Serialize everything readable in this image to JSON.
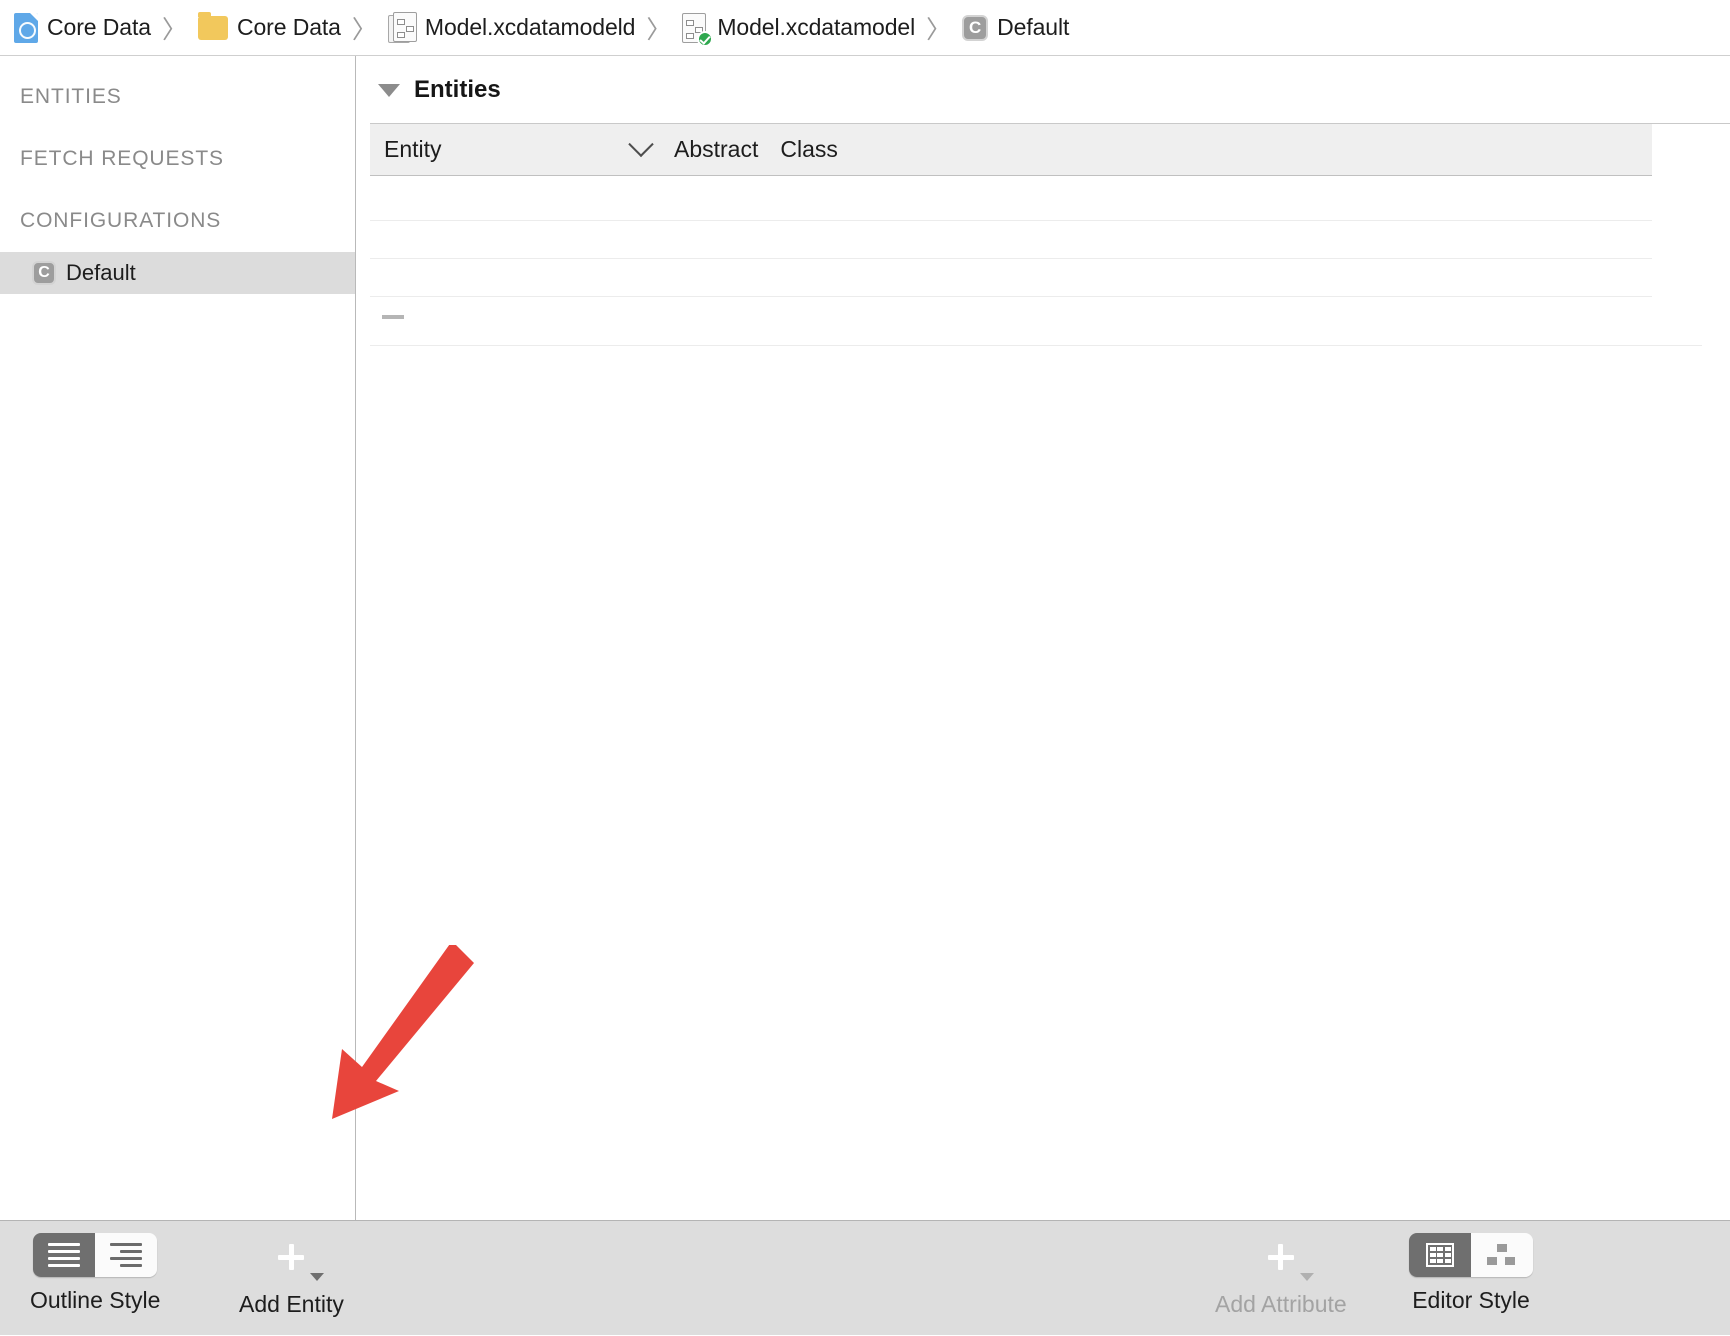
{
  "breadcrumb": {
    "items": [
      {
        "label": "Core Data",
        "icon": "xcode-project-icon"
      },
      {
        "label": "Core Data",
        "icon": "folder-icon"
      },
      {
        "label": "Model.xcdatamodeld",
        "icon": "datamodel-bundle-icon"
      },
      {
        "label": "Model.xcdatamodel",
        "icon": "datamodel-document-checked-icon"
      },
      {
        "label": "Default",
        "icon": "configuration-icon"
      }
    ],
    "separator": "〉"
  },
  "sidebar": {
    "sections": [
      {
        "label": "ENTITIES"
      },
      {
        "label": "FETCH REQUESTS"
      },
      {
        "label": "CONFIGURATIONS"
      }
    ],
    "configuration_row": {
      "label": "Default",
      "badge": "C",
      "selected": true
    }
  },
  "main": {
    "section_title": "Entities",
    "table": {
      "columns": [
        {
          "label": "Entity",
          "sorted": true
        },
        {
          "label": "Abstract"
        },
        {
          "label": "Class"
        }
      ],
      "rows": [],
      "empty_placeholder": "—"
    }
  },
  "toolbar": {
    "outline_style": {
      "label": "Outline Style",
      "segments": [
        {
          "name": "flat-list",
          "selected": true
        },
        {
          "name": "hierarchical-list",
          "selected": false
        }
      ]
    },
    "add_entity": {
      "label": "Add Entity",
      "enabled": true
    },
    "add_attribute": {
      "label": "Add Attribute",
      "enabled": false
    },
    "editor_style": {
      "label": "Editor Style",
      "segments": [
        {
          "name": "table-view",
          "selected": true
        },
        {
          "name": "graph-view",
          "selected": false
        }
      ]
    }
  },
  "annotation": {
    "arrow_color": "#e8453c",
    "points_to": "Add Entity"
  },
  "colors": {
    "selection": "#dcdcdc",
    "toolbar_bg": "#dddddd",
    "table_header_bg": "#efefef",
    "accent_red": "#e8453c"
  }
}
